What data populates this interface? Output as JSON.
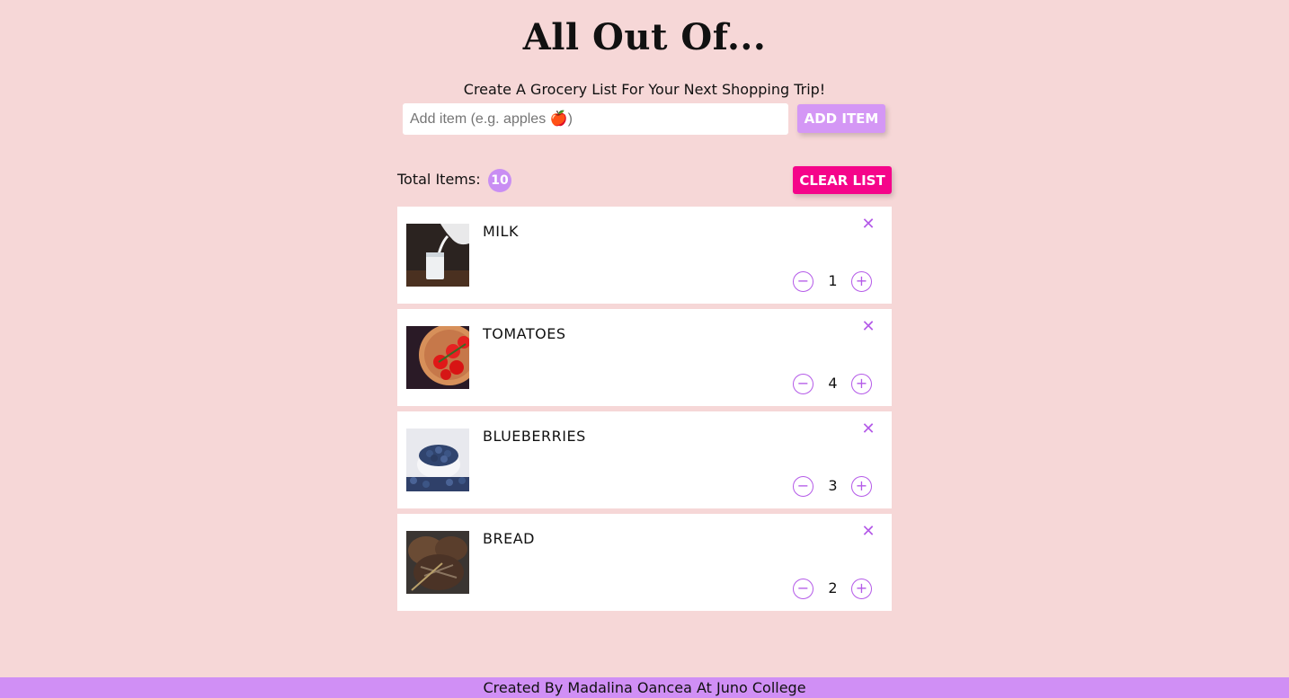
{
  "header": {
    "title": "All Out Of...",
    "subtitle": "Create A Grocery List For Your Next Shopping Trip!"
  },
  "add_form": {
    "placeholder": "Add item (e.g. apples 🍎)",
    "button_label": "ADD ITEM"
  },
  "summary": {
    "total_label": "Total Items:",
    "total_count": "10",
    "clear_label": "CLEAR LIST"
  },
  "items": [
    {
      "name": "MILK",
      "quantity": "1",
      "image": "milk-photo"
    },
    {
      "name": "TOMATOES",
      "quantity": "4",
      "image": "tomatoes-photo"
    },
    {
      "name": "BLUEBERRIES",
      "quantity": "3",
      "image": "blueberries-photo"
    },
    {
      "name": "BREAD",
      "quantity": "2",
      "image": "bread-photo"
    }
  ],
  "icons": {
    "remove": "close-icon",
    "decrement": "minus-circle-icon",
    "increment": "plus-circle-icon"
  },
  "colors": {
    "background": "#f6d7d7",
    "accent": "#d497f5",
    "clear_button": "#f5058a",
    "icon": "#b45ae8",
    "footer": "#d08ff5"
  },
  "footer": {
    "credit": "Created By Madalina Oancea At Juno College"
  }
}
